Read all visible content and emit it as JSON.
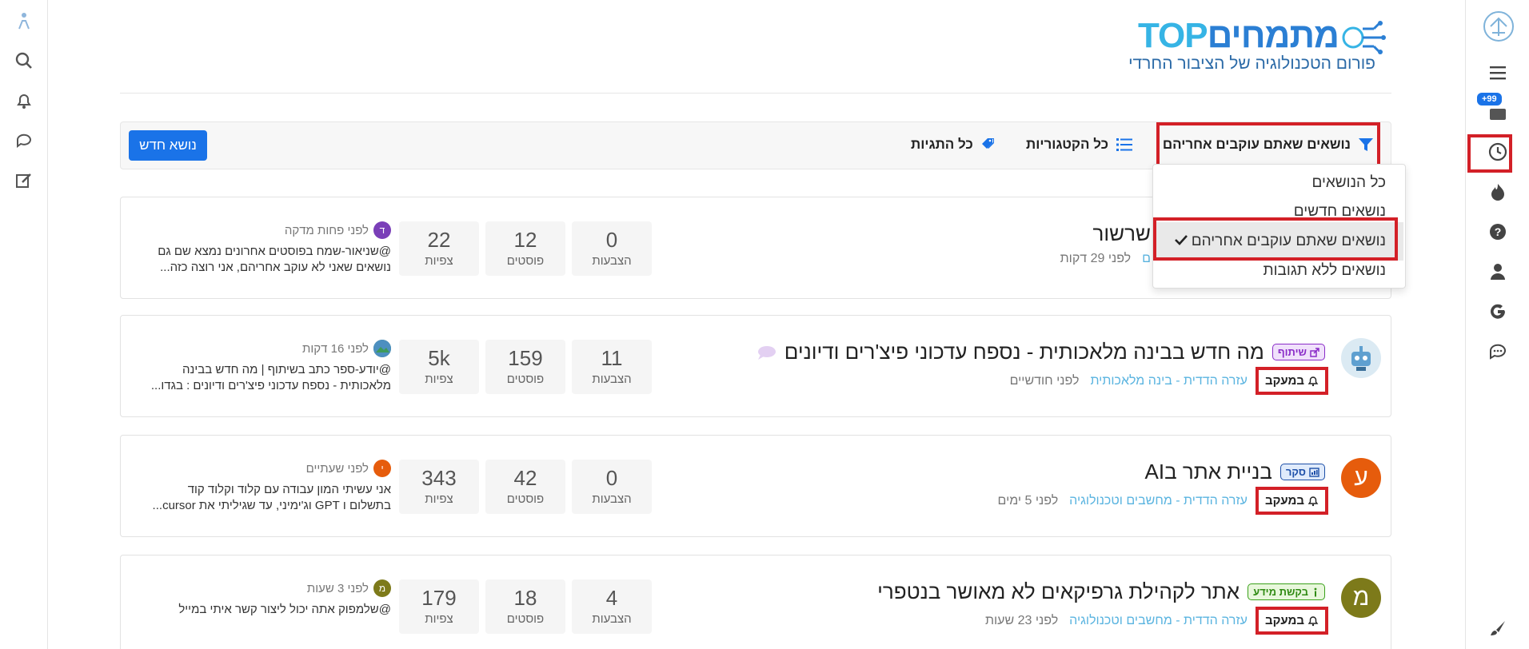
{
  "logo": {
    "brand_part1": "מתמחים",
    "brand_part2": "TOP",
    "subtitle": "פורום הטכנולוגיה של הציבור החרדי"
  },
  "sidebar_right": {
    "unread_badge": "+99"
  },
  "toolbar": {
    "new_topic": "נושא חדש",
    "all_tags": "כל התגיות",
    "all_categories": "כל הקטגוריות",
    "filter_label": "נושאים שאתם עוקבים אחריהם"
  },
  "dropdown": {
    "items": [
      "כל הנושאים",
      "נושאים חדשים",
      "נושאים שאתם עוקבים אחריהם",
      "נושאים ללא תגובות"
    ]
  },
  "stat_labels": {
    "votes": "הצבעות",
    "posts": "פוסטים",
    "views": "צפיות"
  },
  "colors": {
    "accent": "#1a73e8",
    "highlight_red": "#d32027",
    "category_link": "#5ab4e0"
  },
  "topics": [
    {
      "title": "שרשור",
      "category": "ם",
      "time": "לפני 29 דקות",
      "votes": "0",
      "posts": "12",
      "views": "22",
      "last_post": {
        "initial": "ד",
        "time": "לפני פחות מדקה",
        "text": "@שניאור-שמח בפוסטים אחרונים נמצא שם גם נושאים שאני לא עוקב אחריהם, אני רוצה כזה..."
      }
    },
    {
      "tag": "שיתוף",
      "title": "מה חדש בבינה מלאכותית - נספח עדכוני פיצ'רים ודיונים",
      "follow": "במעקב",
      "category": "עזרה הדדית - בינה מלאכותית",
      "time": "לפני חודשיים",
      "votes": "11",
      "posts": "159",
      "views": "5k",
      "last_post": {
        "time": "לפני 16 דקות",
        "text": "@יודע-ספר כתב בשיתוף | מה חדש בבינה מלאכותית - נספח עדכוני פיצ'רים ודיונים : בגדו..."
      }
    },
    {
      "tag": "סקר",
      "title": "בניית אתר בAI",
      "avatar": "ע",
      "follow": "במעקב",
      "category": "עזרה הדדית - מחשבים וטכנולוגיה",
      "time": "לפני 5 ימים",
      "votes": "0",
      "posts": "42",
      "views": "343",
      "last_post": {
        "initial": "י",
        "time": "לפני שעתיים",
        "text": "אני עשיתי המון עבודה עם קלוד וקלוד קוד בתשלום ו GPT וג'ימיני, עד שגיליתי את cursor..."
      }
    },
    {
      "tag": "בקשת מידע",
      "title": "אתר לקהילת גרפיקאים לא מאושר בנטפרי",
      "avatar": "מ",
      "follow": "במעקב",
      "category": "עזרה הדדית - מחשבים וטכנולוגיה",
      "time": "לפני 23 שעות",
      "votes": "4",
      "posts": "18",
      "views": "179",
      "last_post": {
        "initial": "מ",
        "time": "לפני 3 שעות",
        "text": "@שלמפוק אתה יכול ליצור קשר איתי במייל"
      }
    }
  ]
}
